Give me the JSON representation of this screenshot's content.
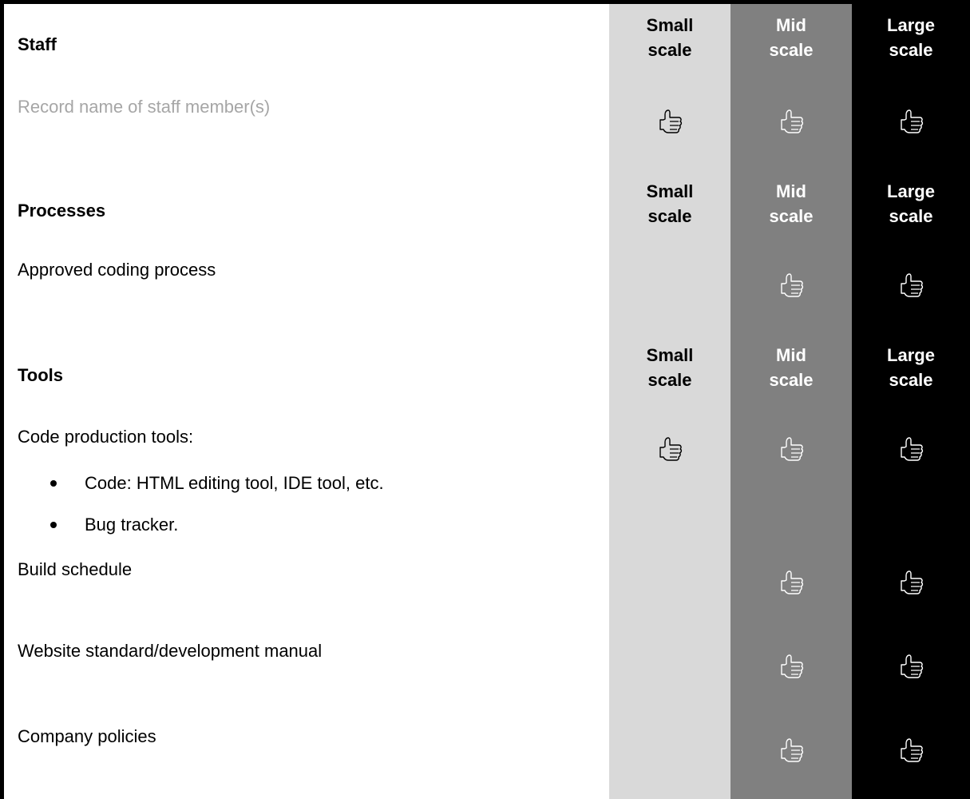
{
  "columns": {
    "small": [
      "Small",
      "scale"
    ],
    "mid": [
      "Mid",
      "scale"
    ],
    "large": [
      "Large",
      "scale"
    ]
  },
  "icon": "thumbs-up-icon",
  "colors": {
    "small": "#d9d9d9",
    "mid": "#808080",
    "large": "#000000"
  },
  "sections": {
    "staff": {
      "heading": "Staff",
      "rows": [
        {
          "label": "Record name of staff member(s)",
          "small": true,
          "mid": true,
          "large": true
        }
      ]
    },
    "processes": {
      "heading": "Processes",
      "rows": [
        {
          "label": "Approved coding process",
          "small": false,
          "mid": true,
          "large": true
        }
      ]
    },
    "tools": {
      "heading": "Tools",
      "rows": [
        {
          "label": "Code production tools:",
          "small": true,
          "mid": true,
          "large": true
        },
        {
          "label": "Build schedule",
          "small": false,
          "mid": true,
          "large": true
        },
        {
          "label": "Website standard/development manual",
          "small": false,
          "mid": true,
          "large": true
        },
        {
          "label": "Company policies",
          "small": false,
          "mid": true,
          "large": true
        }
      ],
      "bullets": [
        "Code: HTML editing tool, IDE tool, etc.",
        "Bug tracker."
      ]
    }
  }
}
